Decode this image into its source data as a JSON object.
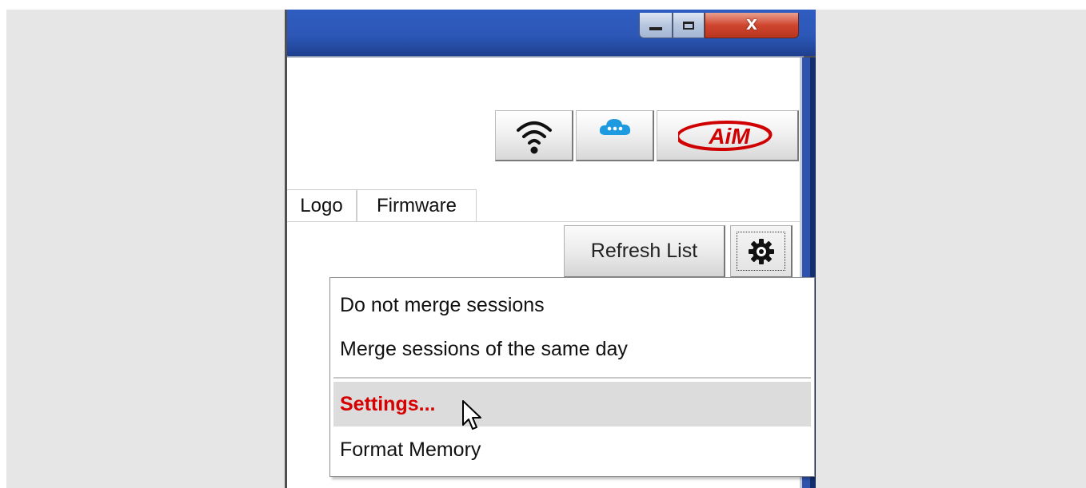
{
  "window": {
    "caption_buttons": {
      "minimize_icon": "minimize-icon",
      "maximize_icon": "maximize-icon",
      "close_glyph": "X"
    }
  },
  "toolbar": {
    "wifi_icon": "wifi-icon",
    "cloud_icon": "cloud-icon",
    "brand_logo": "AiM",
    "brand_color": "#d00000",
    "cloud_color": "#1e9be0"
  },
  "tabs": [
    {
      "label": "Logo"
    },
    {
      "label": "Firmware"
    }
  ],
  "actions": {
    "refresh_label": "Refresh List",
    "settings_icon": "gear-icon"
  },
  "context_menu": {
    "items": [
      {
        "label": "Do not merge sessions"
      },
      {
        "label": "Merge sessions of the same day"
      },
      {
        "label": "Settings...",
        "highlighted": true,
        "color": "#d60000"
      },
      {
        "label": "Format Memory"
      }
    ]
  }
}
